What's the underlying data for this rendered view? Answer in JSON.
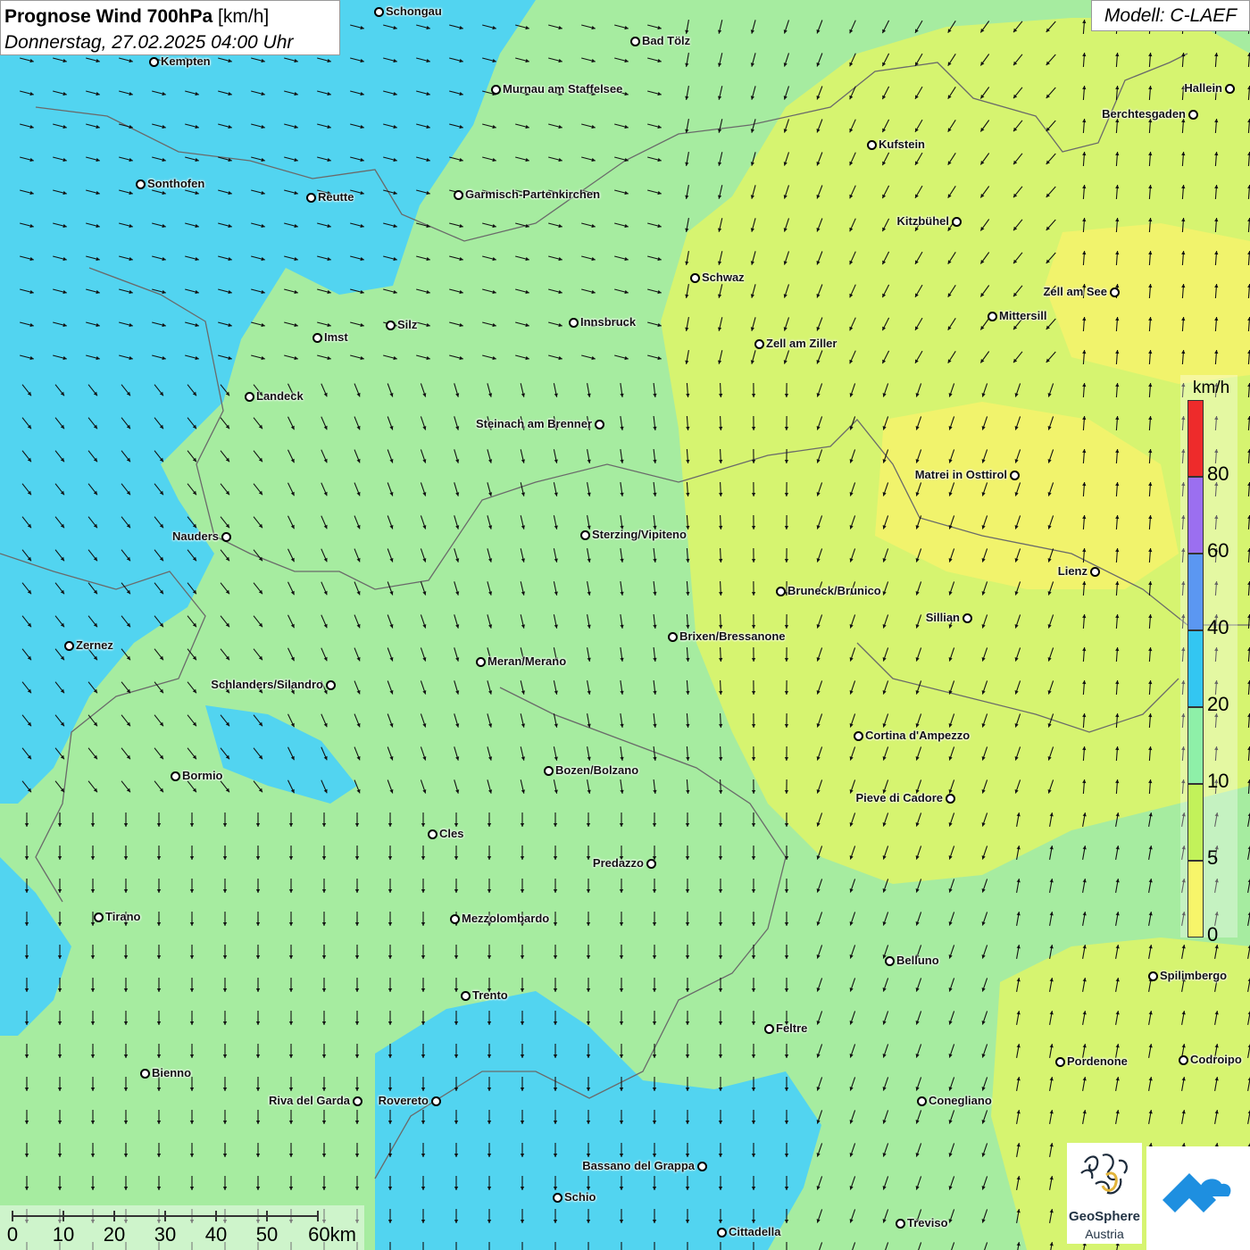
{
  "header": {
    "title_bold": "Prognose Wind 700hPa",
    "title_unit": "[km/h]",
    "datetime": "Donnerstag, 27.02.2025 04:00 Uhr",
    "model": "Modell: C-LAEF"
  },
  "legend": {
    "unit": "km/h",
    "items": [
      {
        "label": "80",
        "color": "#ee2b2b"
      },
      {
        "label": "60",
        "color": "#9b6ff0"
      },
      {
        "label": "40",
        "color": "#5b97f2"
      },
      {
        "label": "20",
        "color": "#33c6f2"
      },
      {
        "label": "10",
        "color": "#8ef0a8"
      },
      {
        "label": "5",
        "color": "#c2f25a"
      },
      {
        "label": "0",
        "color": "#f7f56a"
      }
    ]
  },
  "scale_bar": {
    "labels": [
      "0",
      "10",
      "20",
      "30",
      "40",
      "50",
      "60km"
    ]
  },
  "logos": {
    "geosphere_line1": "GeoSphere",
    "geosphere_line2": "Austria"
  },
  "cities": [
    {
      "name": "Schongau",
      "side": "r"
    },
    {
      "name": "Kempten",
      "side": "r"
    },
    {
      "name": "Bad Tölz",
      "side": "r"
    },
    {
      "name": "Murnau am Staffelsee",
      "side": "r"
    },
    {
      "name": "Hallein",
      "side": "l"
    },
    {
      "name": "Berchtesgaden",
      "side": "l"
    },
    {
      "name": "Kufstein",
      "side": "r"
    },
    {
      "name": "Sonthofen",
      "side": "r"
    },
    {
      "name": "Reutte",
      "side": "r"
    },
    {
      "name": "Garmisch-Partenkirchen",
      "side": "r"
    },
    {
      "name": "Kitzbühel",
      "side": "l"
    },
    {
      "name": "Schwaz",
      "side": "r"
    },
    {
      "name": "Zell am See",
      "side": "l"
    },
    {
      "name": "Mittersill",
      "side": "r"
    },
    {
      "name": "Innsbruck",
      "side": "r"
    },
    {
      "name": "Silz",
      "side": "r"
    },
    {
      "name": "Imst",
      "side": "r"
    },
    {
      "name": "Zell am Ziller",
      "side": "r"
    },
    {
      "name": "Landeck",
      "side": "r"
    },
    {
      "name": "Steinach am Brenner",
      "side": "l"
    },
    {
      "name": "Matrei in Osttirol",
      "side": "l"
    },
    {
      "name": "Nauders",
      "side": "l"
    },
    {
      "name": "Sterzing/Vipiteno",
      "side": "r"
    },
    {
      "name": "Lienz",
      "side": "l"
    },
    {
      "name": "Bruneck/Brunico",
      "side": "r"
    },
    {
      "name": "Sillian",
      "side": "l"
    },
    {
      "name": "Brixen/Bressanone",
      "side": "r"
    },
    {
      "name": "Zernez",
      "side": "r"
    },
    {
      "name": "Meran/Merano",
      "side": "r"
    },
    {
      "name": "Schlanders/Silandro",
      "side": "l"
    },
    {
      "name": "Cortina d'Ampezzo",
      "side": "r"
    },
    {
      "name": "Bozen/Bolzano",
      "side": "r"
    },
    {
      "name": "Bormio",
      "side": "r"
    },
    {
      "name": "Pieve di Cadore",
      "side": "l"
    },
    {
      "name": "Cles",
      "side": "r"
    },
    {
      "name": "Predazzo",
      "side": "l"
    },
    {
      "name": "Tirano",
      "side": "r"
    },
    {
      "name": "Mezzolombardo",
      "side": "r"
    },
    {
      "name": "Belluno",
      "side": "r"
    },
    {
      "name": "Spilimbergo",
      "side": "r"
    },
    {
      "name": "Trento",
      "side": "r"
    },
    {
      "name": "Feltre",
      "side": "r"
    },
    {
      "name": "Pordenone",
      "side": "r"
    },
    {
      "name": "Codroipo",
      "side": "r"
    },
    {
      "name": "Bienno",
      "side": "r"
    },
    {
      "name": "Riva del Garda",
      "side": "l"
    },
    {
      "name": "Rovereto",
      "side": "l"
    },
    {
      "name": "Conegliano",
      "side": "r"
    },
    {
      "name": "Bassano del Grappa",
      "side": "l"
    },
    {
      "name": "Schio",
      "side": "r"
    },
    {
      "name": "Treviso",
      "side": "r"
    },
    {
      "name": "Cittadella",
      "side": "r"
    }
  ]
}
